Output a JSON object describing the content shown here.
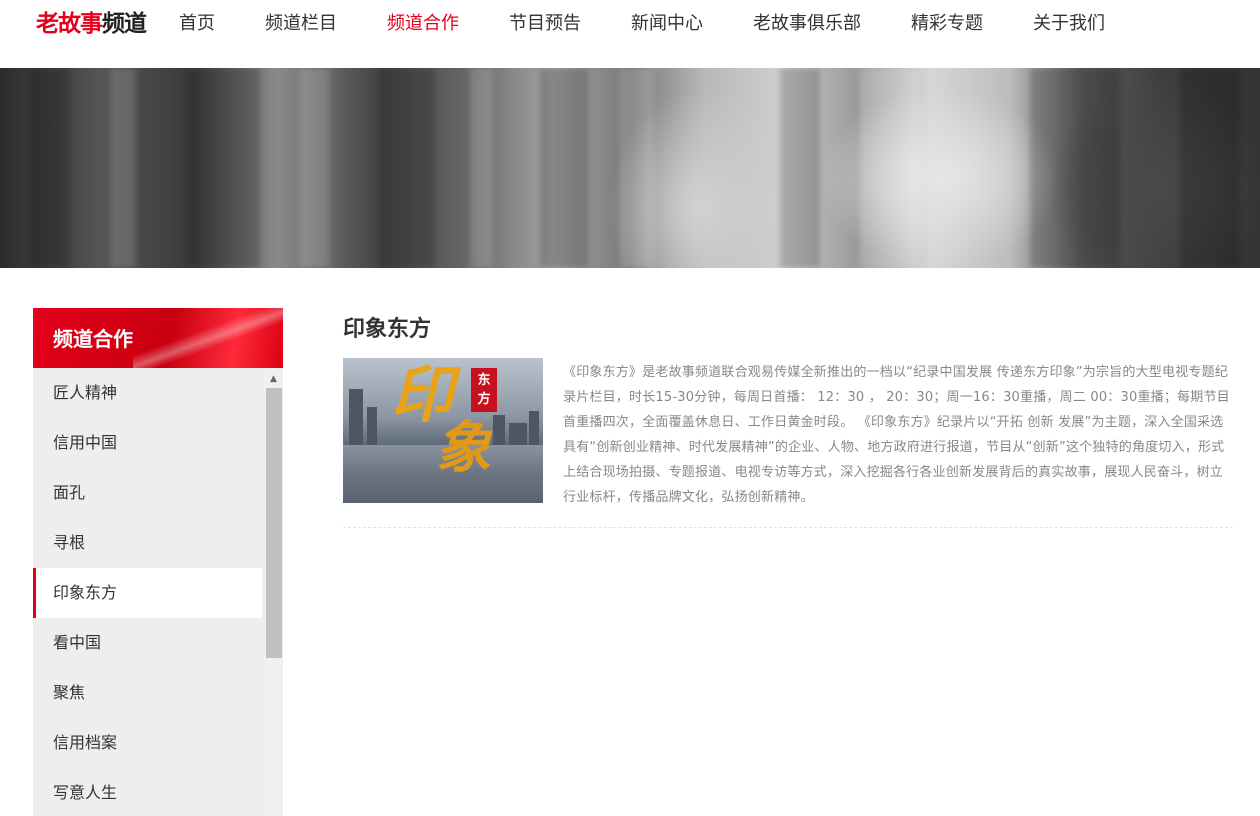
{
  "header": {
    "logo_red": "老故事",
    "logo_dark": "频道",
    "nav": [
      {
        "label": "首页",
        "active": false
      },
      {
        "label": "频道栏目",
        "active": false
      },
      {
        "label": "频道合作",
        "active": true
      },
      {
        "label": "节目预告",
        "active": false
      },
      {
        "label": "新闻中心",
        "active": false
      },
      {
        "label": "老故事俱乐部",
        "active": false
      },
      {
        "label": "精彩专题",
        "active": false
      },
      {
        "label": "关于我们",
        "active": false
      }
    ]
  },
  "sidebar": {
    "title": "频道合作",
    "items": [
      {
        "label": "匠人精神",
        "active": false
      },
      {
        "label": "信用中国",
        "active": false
      },
      {
        "label": "面孔",
        "active": false
      },
      {
        "label": "寻根",
        "active": false
      },
      {
        "label": "印象东方",
        "active": true
      },
      {
        "label": "看中国",
        "active": false
      },
      {
        "label": "聚焦",
        "active": false
      },
      {
        "label": "信用档案",
        "active": false
      },
      {
        "label": "写意人生",
        "active": false
      }
    ]
  },
  "content": {
    "title": "印象东方",
    "thumbnail": {
      "big_char_1": "印",
      "big_char_2": "象",
      "seal_line_1": "东",
      "seal_line_2": "方"
    },
    "description": "《印象东方》是老故事频道联合观易传媒全新推出的一档以“纪录中国发展 传递东方印象”为宗旨的大型电视专题纪录片栏目，时长15-30分钟，每周日首播： 12：30 ， 20：30；周一16：30重播，周二 00：30重播；每期节目首重播四次，全面覆盖休息日、工作日黄金时段。 《印象东方》纪录片以“开拓 创新 发展”为主题，深入全国采选具有“创新创业精神、时代发展精神”的企业、人物、地方政府进行报道，节目从“创新”这个独特的角度切入，形式上结合现场拍摄、专题报道、电视专访等方式，深入挖掘各行各业创新发展背后的真实故事，展现人民奋斗，树立行业标杆，传播品牌文化，弘扬创新精神。"
  },
  "colors": {
    "accent": "#e3001b",
    "sidebar_bg": "#eeeeee",
    "body_text": "#888888"
  }
}
